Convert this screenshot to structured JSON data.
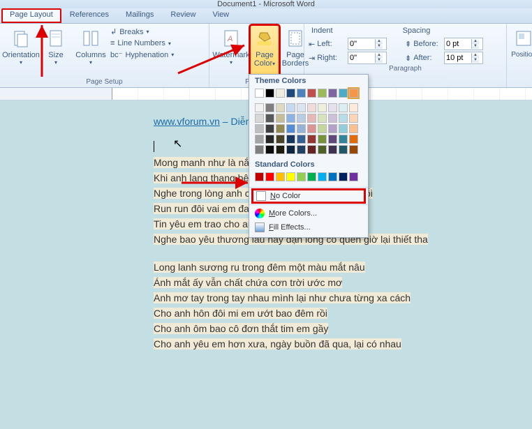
{
  "title": "Document1 - Microsoft Word",
  "tabs": [
    "Page Layout",
    "References",
    "Mailings",
    "Review",
    "View"
  ],
  "activeTab": 0,
  "ribbon": {
    "pageSetup": {
      "label": "Page Setup",
      "orientation": "Orientation",
      "size": "Size",
      "columns": "Columns",
      "breaks": "Breaks",
      "lineNumbers": "Line Numbers",
      "hyphenation": "Hyphenation"
    },
    "pageBackground": {
      "label": "Page B",
      "watermark": "Watermark",
      "pageColor": "Page Color",
      "pageBorders": "Page Borders"
    },
    "paragraph": {
      "label": "Paragraph",
      "indentHead": "Indent",
      "spacingHead": "Spacing",
      "leftLabel": "Left:",
      "rightLabel": "Right:",
      "beforeLabel": "Before:",
      "afterLabel": "After:",
      "leftVal": "0\"",
      "rightVal": "0\"",
      "beforeVal": "0 pt",
      "afterVal": "10 pt"
    },
    "arrange": {
      "position": "Position"
    }
  },
  "dropdown": {
    "themeTitle": "Theme Colors",
    "standardTitle": "Standard Colors",
    "noColor": "No Color",
    "moreColors": "More Colors...",
    "fillEffects": "Fill Effects...",
    "themeRow1": [
      "#ffffff",
      "#000000",
      "#eeece1",
      "#1f497d",
      "#4f81bd",
      "#c0504d",
      "#9bbb59",
      "#8064a2",
      "#4bacc6",
      "#f79646"
    ],
    "themeShades": [
      [
        "#f2f2f2",
        "#7f7f7f",
        "#ddd9c3",
        "#c6d9f0",
        "#dbe5f1",
        "#f2dcdb",
        "#ebf1dd",
        "#e5e0ec",
        "#dbeef3",
        "#fdeada"
      ],
      [
        "#d8d8d8",
        "#595959",
        "#c4bd97",
        "#8db3e2",
        "#b8cce4",
        "#e5b9b7",
        "#d7e3bc",
        "#ccc1d9",
        "#b7dde8",
        "#fbd5b5"
      ],
      [
        "#bfbfbf",
        "#3f3f3f",
        "#938953",
        "#548dd4",
        "#95b3d7",
        "#d99694",
        "#c3d69b",
        "#b2a2c7",
        "#92cddc",
        "#fac08f"
      ],
      [
        "#a5a5a5",
        "#262626",
        "#494429",
        "#17365d",
        "#366092",
        "#953734",
        "#76923c",
        "#5f497a",
        "#31859b",
        "#e36c09"
      ],
      [
        "#7f7f7f",
        "#0c0c0c",
        "#1d1b10",
        "#0f243e",
        "#244061",
        "#632423",
        "#4f6128",
        "#3f3151",
        "#205867",
        "#974806"
      ]
    ],
    "standardRow": [
      "#c00000",
      "#ff0000",
      "#ffc000",
      "#ffff00",
      "#92d050",
      "#00b050",
      "#00b0f0",
      "#0070c0",
      "#002060",
      "#7030a0"
    ]
  },
  "doc": {
    "link": "www.vforum.vn",
    "linkAfter": " – Diễn đàn chia sẻ kiến thức",
    "p1": [
      "Mong manh như là nắng, nắng hoàng qua",
      "Khi anh lang thang bên em đường chiều nắng xa",
      "Nghe trong lòng anh còn bao lời cám ơn, lời xin lỗi",
      "Run run đôi vai em đau ngày nào bước đi",
      "Tin yêu em trao cho anh mất đi sao đành",
      "Nghe bao yêu thương lâu nay dặn lòng cố quên giờ lại thiết tha"
    ],
    "p2": [
      "Long lanh sương ru trong đêm một màu mắt nâu",
      "Ánh mắt ấy vẫn chất chứa cơn trời ước mơ",
      "Anh mơ tay trong tay nhau mình lại như chưa từng xa cách",
      "Cho anh hôn đôi mi em ướt bao đêm rồi",
      "Cho anh ôm bao cô đơn thắt tim em gầy",
      "Cho anh yêu em hơn xưa, ngày buồn đã qua, lại có nhau"
    ]
  }
}
